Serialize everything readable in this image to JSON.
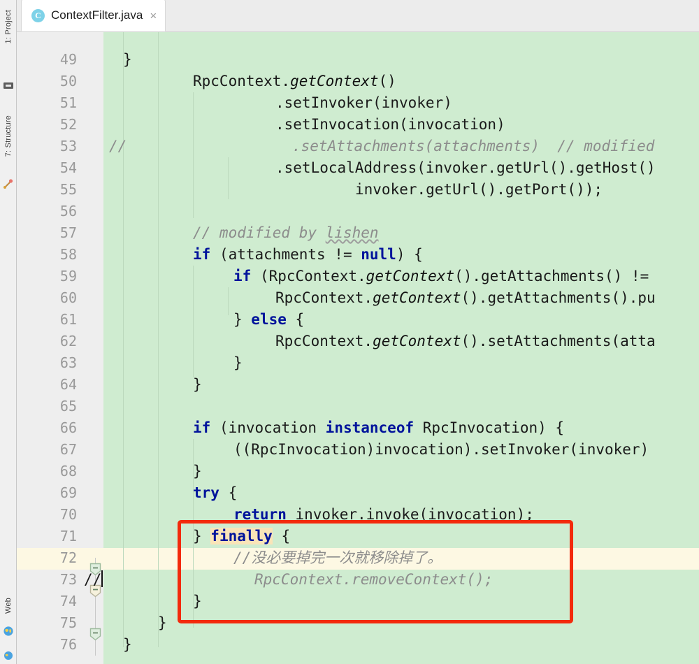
{
  "window": {
    "background_color": "#f2f2f2",
    "editor_background_color": "#cfecd0",
    "current_line_color": "#fdf8e3",
    "annotation_color": "#f32a0c",
    "keyword_color": "#00139b",
    "comment_color": "#8c8c8c"
  },
  "toolbar_left": {
    "items": [
      {
        "label": "1: Project",
        "icon": "project-icon"
      },
      {
        "label": "7: Structure",
        "icon": "structure-icon"
      },
      {
        "label": "Web",
        "icon": "web-globe-icon"
      }
    ]
  },
  "tab_strip": {
    "active_tab": {
      "title": "ContextFilter.java",
      "icon_letter": "C",
      "icon_name": "java-class-icon",
      "close_label": "×"
    }
  },
  "editor": {
    "current_line": 73,
    "gutter_prefix": "//",
    "first_line": 49,
    "last_line": 76,
    "line_numbers": [
      "49",
      "50",
      "51",
      "52",
      "53",
      "54",
      "55",
      "56",
      "57",
      "58",
      "59",
      "60",
      "61",
      "62",
      "63",
      "64",
      "65",
      "66",
      "67",
      "68",
      "69",
      "70",
      "71",
      "72",
      "73",
      "74",
      "75",
      "76"
    ],
    "chinese_comment": "//没必要掉完一次就移除掉了。",
    "lines": [
      {
        "n": "49",
        "text": "}"
      },
      {
        "n": "50",
        "text": "RpcContext.getContext()"
      },
      {
        "n": "51",
        "text": ".setInvoker(invoker)"
      },
      {
        "n": "52",
        "text": ".setInvocation(invocation)"
      },
      {
        "n": "53",
        "text": "//            .setAttachments(attachments)  // modified"
      },
      {
        "n": "54",
        "text": ".setLocalAddress(invoker.getUrl().getHost()"
      },
      {
        "n": "55",
        "text": "invoker.getUrl().getPort());"
      },
      {
        "n": "56",
        "text": ""
      },
      {
        "n": "57",
        "text": "// modified by lishen"
      },
      {
        "n": "58",
        "text": "if (attachments != null) {"
      },
      {
        "n": "59",
        "text": "if (RpcContext.getContext().getAttachments() !="
      },
      {
        "n": "60",
        "text": "RpcContext.getContext().getAttachments().pu"
      },
      {
        "n": "61",
        "text": "} else {"
      },
      {
        "n": "62",
        "text": "RpcContext.getContext().setAttachments(atta"
      },
      {
        "n": "63",
        "text": "}"
      },
      {
        "n": "64",
        "text": "}"
      },
      {
        "n": "65",
        "text": ""
      },
      {
        "n": "66",
        "text": "if (invocation instanceof RpcInvocation) {"
      },
      {
        "n": "67",
        "text": "((RpcInvocation)invocation).setInvoker(invoker)"
      },
      {
        "n": "68",
        "text": "}"
      },
      {
        "n": "69",
        "text": "try {"
      },
      {
        "n": "70",
        "text": "return invoker.invoke(invocation);"
      },
      {
        "n": "71",
        "text": "} finally {"
      },
      {
        "n": "72",
        "text": "//没必要掉完一次就移除掉了。"
      },
      {
        "n": "73",
        "text": "RpcContext.removeContext();"
      },
      {
        "n": "74",
        "text": "}"
      },
      {
        "n": "75",
        "text": "}"
      },
      {
        "n": "76",
        "text": "}"
      }
    ],
    "fold_markers": [
      {
        "line": "72",
        "type": "collapse-marker"
      },
      {
        "line": "73",
        "type": "collapse-marker"
      },
      {
        "line": "75",
        "type": "collapse-marker"
      }
    ],
    "annotation": {
      "name": "red-highlight-box",
      "covers_lines": "71-74"
    }
  }
}
